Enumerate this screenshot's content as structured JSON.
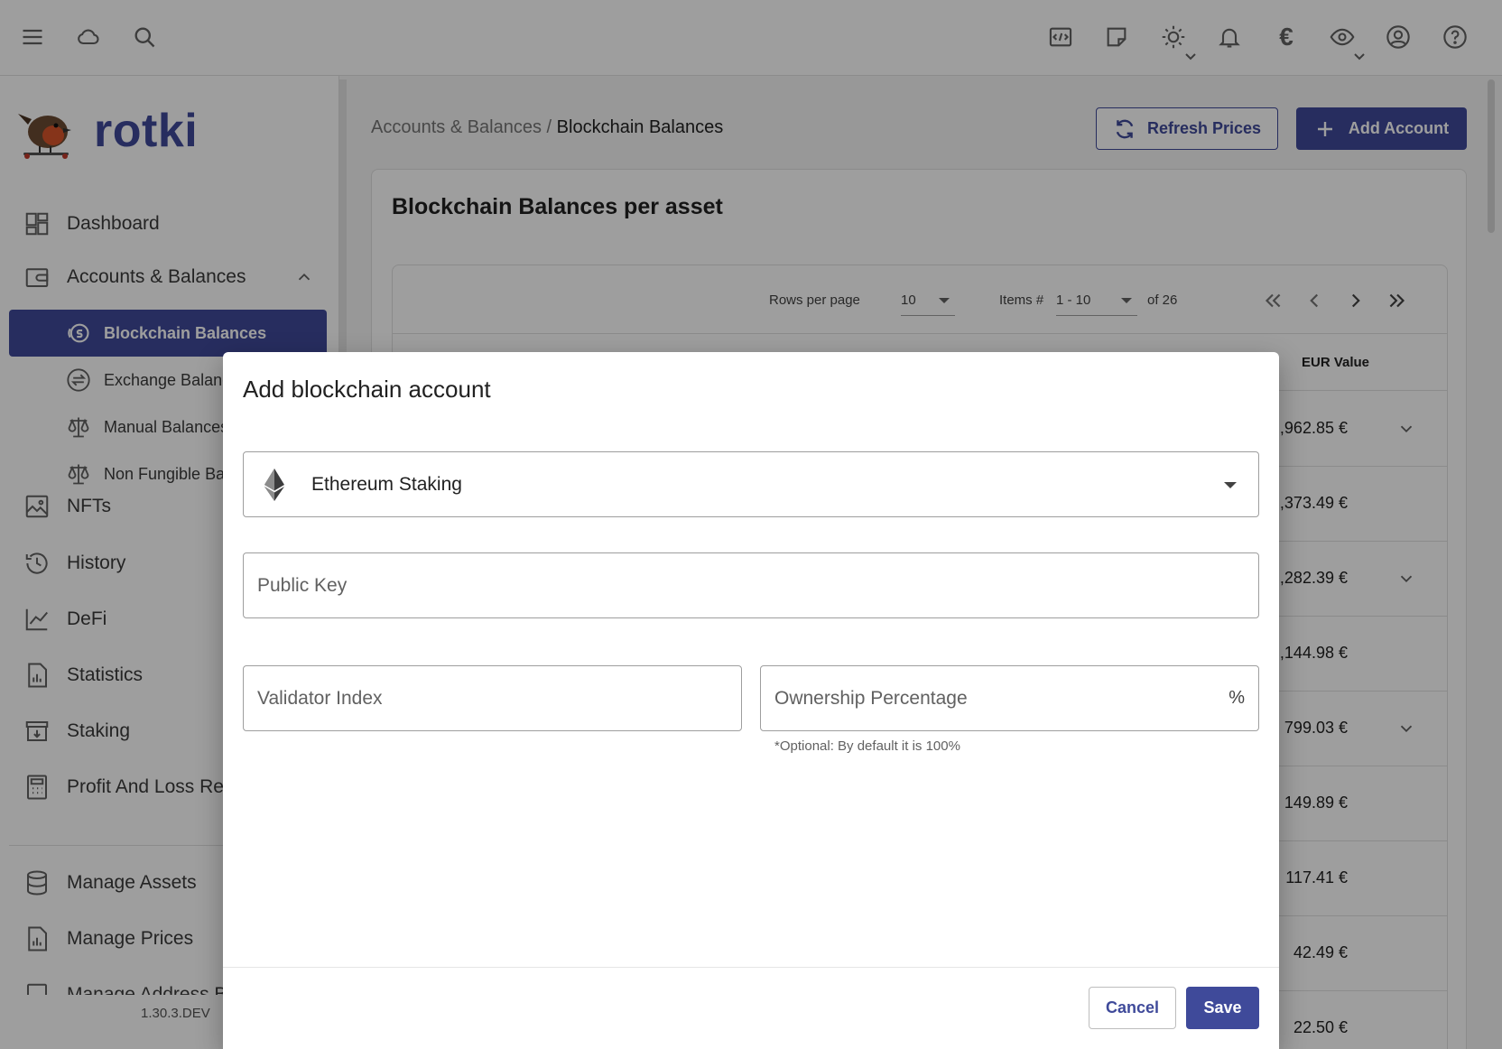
{
  "app": {
    "name": "rotki",
    "version": "1.30.3.DEV"
  },
  "topbar": {
    "icons": [
      "menu-icon",
      "cloud-icon",
      "search-icon",
      "code-icon",
      "notes-icon",
      "theme-sun-icon",
      "bell-icon",
      "euro-icon",
      "eye-icon",
      "account-icon",
      "help-icon"
    ],
    "currency_symbol": "€"
  },
  "sidebar": {
    "items": [
      {
        "label": "Dashboard",
        "icon": "dashboard-icon"
      },
      {
        "label": "Accounts & Balances",
        "icon": "wallet-icon",
        "expanded": true
      },
      {
        "label": "Blockchain Balances",
        "icon": "coins-icon",
        "active": true
      },
      {
        "label": "Exchange Balances",
        "icon": "exchange-icon"
      },
      {
        "label": "Manual Balances",
        "icon": "scale-icon"
      },
      {
        "label": "Non Fungible Balances",
        "icon": "scale-icon"
      },
      {
        "label": "NFTs",
        "icon": "image-icon"
      },
      {
        "label": "History",
        "icon": "history-icon"
      },
      {
        "label": "DeFi",
        "icon": "chart-line-icon"
      },
      {
        "label": "Statistics",
        "icon": "statistics-icon"
      },
      {
        "label": "Staking",
        "icon": "staking-icon"
      },
      {
        "label": "Profit And Loss Report",
        "icon": "calculator-icon"
      },
      {
        "label": "Manage Assets",
        "icon": "database-icon"
      },
      {
        "label": "Manage Prices",
        "icon": "prices-icon"
      },
      {
        "label": "Manage Address Book",
        "icon": "address-book-icon"
      }
    ]
  },
  "header": {
    "breadcrumb_parent": "Accounts & Balances",
    "breadcrumb_separator": " / ",
    "breadcrumb_current": "Blockchain Balances",
    "refresh_label": "Refresh Prices",
    "add_label": "Add Account"
  },
  "card": {
    "title": "Blockchain Balances per asset",
    "pager": {
      "rows_per_page_label": "Rows per page",
      "rows_per_page_value": "10",
      "items_label": "Items #",
      "items_value": "1 - 10",
      "of_total": "of 26"
    },
    "column_header": "EUR Value",
    "rows": [
      {
        "value": ",962.85 €",
        "expandable": true
      },
      {
        "value": ",373.49 €",
        "expandable": false
      },
      {
        "value": ",282.39 €",
        "expandable": true
      },
      {
        "value": ",144.98 €",
        "expandable": false
      },
      {
        "value": "799.03 €",
        "expandable": true
      },
      {
        "value": "149.89 €",
        "expandable": false
      },
      {
        "value": "117.41 €",
        "expandable": false
      },
      {
        "value": "42.49 €",
        "expandable": false
      },
      {
        "value": "22.50 €",
        "expandable": false
      }
    ]
  },
  "dialog": {
    "title": "Add blockchain account",
    "chain_value": "Ethereum Staking",
    "public_key_placeholder": "Public Key",
    "validator_placeholder": "Validator Index",
    "ownership_placeholder": "Ownership Percentage",
    "ownership_suffix": "%",
    "ownership_hint": "*Optional: By default it is 100%",
    "cancel_label": "Cancel",
    "save_label": "Save"
  },
  "colors": {
    "primary": "#3f4a9a",
    "overlay": "rgba(0,0,0,0.38)"
  }
}
